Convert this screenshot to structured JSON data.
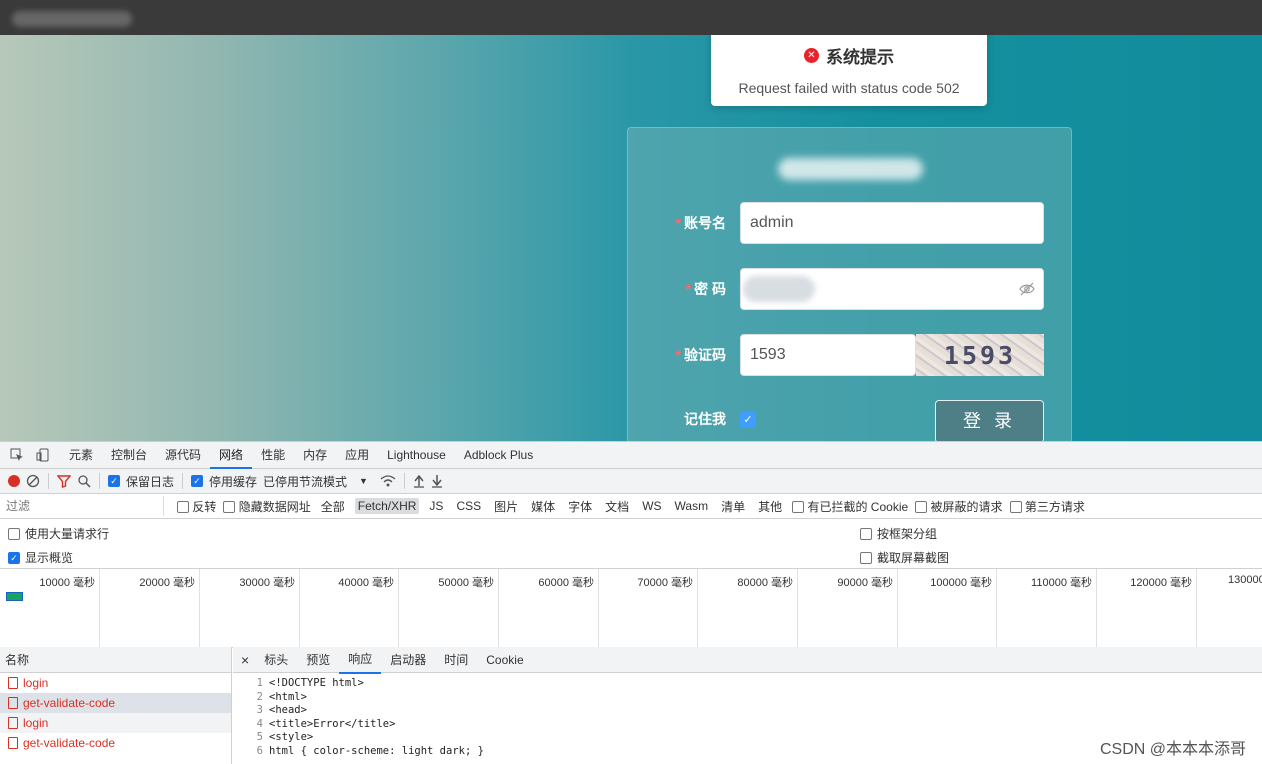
{
  "toast": {
    "title": "系统提示",
    "message": "Request failed with status code 502"
  },
  "login": {
    "username_label": "账号名",
    "username_value": "admin",
    "password_label": "密 码",
    "captcha_label": "验证码",
    "captcha_value": "1593",
    "captcha_image_text": "1593",
    "remember_label": "记住我",
    "login_button": "登 录",
    "required_mark": "*"
  },
  "devtools": {
    "tabs": [
      "元素",
      "控制台",
      "源代码",
      "网络",
      "性能",
      "内存",
      "应用",
      "Lighthouse",
      "Adblock Plus"
    ],
    "active_tab": "网络",
    "toolbar": {
      "preserve_log": "保留日志",
      "disable_cache": "停用缓存",
      "throttle": "已停用节流模式"
    },
    "filter": {
      "placeholder": "过滤",
      "invert": "反转",
      "hide_data_urls": "隐藏数据网址",
      "types": [
        "全部",
        "Fetch/XHR",
        "JS",
        "CSS",
        "图片",
        "媒体",
        "字体",
        "文档",
        "WS",
        "Wasm",
        "清单",
        "其他"
      ],
      "active_type": "Fetch/XHR",
      "blocked_cookies": "有已拦截的 Cookie",
      "blocked_requests": "被屏蔽的请求",
      "third_party": "第三方请求"
    },
    "options": {
      "big_rows": "使用大量请求行",
      "group_by_frame": "按框架分组",
      "show_overview": "显示概览",
      "capture_screenshots": "截取屏幕截图"
    },
    "timeline_ticks": [
      "10000 毫秒",
      "20000 毫秒",
      "30000 毫秒",
      "40000 毫秒",
      "50000 毫秒",
      "60000 毫秒",
      "70000 毫秒",
      "80000 毫秒",
      "90000 毫秒",
      "100000 毫秒",
      "110000 毫秒",
      "120000 毫秒",
      "130000"
    ],
    "names_header": "名称",
    "requests": [
      "login",
      "get-validate-code",
      "login",
      "get-validate-code"
    ],
    "detail_tabs": [
      "标头",
      "预览",
      "响应",
      "启动器",
      "时间",
      "Cookie"
    ],
    "active_detail_tab": "响应",
    "close_symbol": "×",
    "response_lines": [
      {
        "n": "1",
        "text": "<!DOCTYPE html>"
      },
      {
        "n": "2",
        "text": "<html>"
      },
      {
        "n": "3",
        "text": "<head>"
      },
      {
        "n": "4",
        "text": "<title>Error</title>"
      },
      {
        "n": "5",
        "text": "<style>"
      },
      {
        "n": "6",
        "text": "html { color-scheme: light dark; }"
      }
    ]
  },
  "watermark": "CSDN @本本本添哥"
}
